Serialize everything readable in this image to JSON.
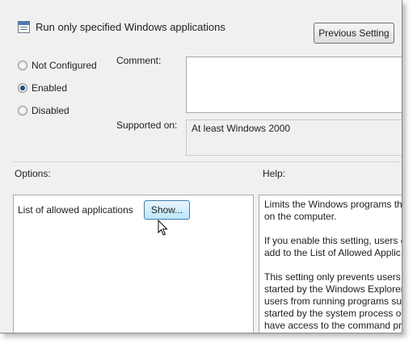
{
  "window": {
    "title": "Run only specified Windows applications",
    "previous_setting_label": "Previous Setting"
  },
  "state": {
    "options": [
      {
        "label": "Not Configured",
        "selected": false
      },
      {
        "label": "Enabled",
        "selected": true
      },
      {
        "label": "Disabled",
        "selected": false
      }
    ]
  },
  "comment": {
    "label": "Comment:",
    "value": ""
  },
  "supported": {
    "label": "Supported on:",
    "value": "At least Windows 2000"
  },
  "options_section": {
    "label": "Options:",
    "item_label": "List of allowed applications",
    "show_button_label": "Show..."
  },
  "help_section": {
    "label": "Help:",
    "lines": [
      "Limits the Windows programs th",
      "on the computer.",
      "",
      "If you enable this setting, users c",
      "add to the List of Allowed Applic",
      "",
      "This setting only prevents users t",
      "started by the Windows Explorer",
      "users from running programs su",
      "started by the system process or",
      "have access to the command pr"
    ]
  },
  "icons": {
    "title_icon": "policy-setting-icon",
    "cursor": "mouse-pointer-icon"
  },
  "colors": {
    "window_bg": "#f0f0f0",
    "button_hover_bg": "#bee6fd",
    "radio_selected": "#1b4a8a"
  }
}
